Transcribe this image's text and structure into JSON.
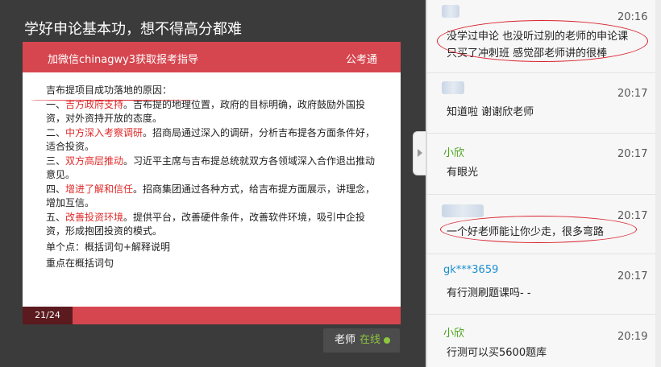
{
  "course": {
    "title": "学好申论基本功，想不得高分都难"
  },
  "slide": {
    "header_text": "加微信chinagwy3获取报考指导",
    "brand": "公考通",
    "heading": "吉布提项目成功落地的原因：",
    "points": [
      {
        "prefix": "一、",
        "highlight": "吉方政府支持",
        "rest": "。吉布提的地理位置，政府的目标明确，政府鼓励外国投资，对外资持开放的态度。"
      },
      {
        "prefix": "二、",
        "highlight": "中方深入考察调研",
        "rest": "。招商局通过深入的调研，分析吉布提各方面条件好，适合投资。"
      },
      {
        "prefix": "三、",
        "highlight": "双方高层推动",
        "rest": "。习近平主席与吉布提总统就双方各领域深入合作退出推动意见。"
      },
      {
        "prefix": "四、",
        "highlight": "增进了解和信任",
        "rest": "。招商集团通过各种方式，给吉布提方面展示，讲理念，增加互信。"
      },
      {
        "prefix": "五、",
        "highlight": "改善投资环境",
        "rest": "。提供平台，改善硬件条件，改善软件环境，吸引中企投资，形成抱团投资的模式。"
      }
    ],
    "note1": "单个点：概括词句+解释说明",
    "note2": "重点在概括词句",
    "page": "21/24"
  },
  "teacher_status": {
    "label": "老师",
    "status": "在线",
    "status_color": "#8dc63f"
  },
  "chat": {
    "messages": [
      {
        "name": "",
        "time": "20:16",
        "text_lines": [
          "没学过申论 也没听过别的老师的申论课",
          "只买了冲刺班 感觉邵老师讲的很棒"
        ]
      },
      {
        "name": "",
        "time": "20:17",
        "text_lines": [
          "知道啦 谢谢欣老师"
        ]
      },
      {
        "name": "小欣",
        "time": "20:17",
        "text_lines": [
          "有眼光"
        ]
      },
      {
        "name": "",
        "time": "20:17",
        "text_lines": [
          "一个好老师能让你少走，很多弯路"
        ]
      },
      {
        "name": "gk***3659",
        "time": "20:17",
        "text_lines": [
          "有行测刷题课吗- -"
        ]
      },
      {
        "name": "小欣",
        "time": "20:19",
        "text_lines": [
          "行测可以买5600题库"
        ]
      }
    ]
  },
  "colors": {
    "accent_red": "#d6464f",
    "highlight_red": "#e02a2a",
    "name_green": "#49a11a",
    "name_blue": "#1a8fd0"
  }
}
